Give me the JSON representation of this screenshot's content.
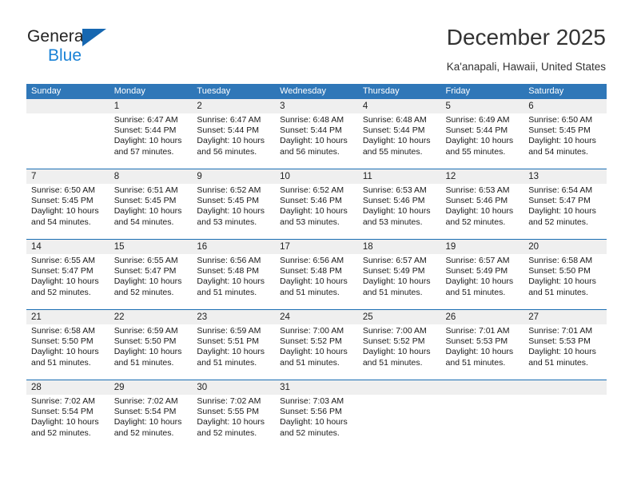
{
  "brand": {
    "name_part1": "General",
    "name_part2": "Blue",
    "accent_color": "#1a82d6",
    "triangle_color": "#1667b1"
  },
  "header": {
    "title": "December 2025",
    "location": "Ka'anapali, Hawaii, United States",
    "header_bg": "#2f77b8",
    "row_separator_color": "#1a6eb4",
    "daynum_bg": "#efefef"
  },
  "weekday_headers": [
    "Sunday",
    "Monday",
    "Tuesday",
    "Wednesday",
    "Thursday",
    "Friday",
    "Saturday"
  ],
  "weeks": [
    {
      "days": [
        {
          "num": "",
          "sunrise": "",
          "sunset": "",
          "daylight_1": "",
          "daylight_2": ""
        },
        {
          "num": "1",
          "sunrise": "Sunrise: 6:47 AM",
          "sunset": "Sunset: 5:44 PM",
          "daylight_1": "Daylight: 10 hours",
          "daylight_2": "and 57 minutes."
        },
        {
          "num": "2",
          "sunrise": "Sunrise: 6:47 AM",
          "sunset": "Sunset: 5:44 PM",
          "daylight_1": "Daylight: 10 hours",
          "daylight_2": "and 56 minutes."
        },
        {
          "num": "3",
          "sunrise": "Sunrise: 6:48 AM",
          "sunset": "Sunset: 5:44 PM",
          "daylight_1": "Daylight: 10 hours",
          "daylight_2": "and 56 minutes."
        },
        {
          "num": "4",
          "sunrise": "Sunrise: 6:48 AM",
          "sunset": "Sunset: 5:44 PM",
          "daylight_1": "Daylight: 10 hours",
          "daylight_2": "and 55 minutes."
        },
        {
          "num": "5",
          "sunrise": "Sunrise: 6:49 AM",
          "sunset": "Sunset: 5:44 PM",
          "daylight_1": "Daylight: 10 hours",
          "daylight_2": "and 55 minutes."
        },
        {
          "num": "6",
          "sunrise": "Sunrise: 6:50 AM",
          "sunset": "Sunset: 5:45 PM",
          "daylight_1": "Daylight: 10 hours",
          "daylight_2": "and 54 minutes."
        }
      ]
    },
    {
      "days": [
        {
          "num": "7",
          "sunrise": "Sunrise: 6:50 AM",
          "sunset": "Sunset: 5:45 PM",
          "daylight_1": "Daylight: 10 hours",
          "daylight_2": "and 54 minutes."
        },
        {
          "num": "8",
          "sunrise": "Sunrise: 6:51 AM",
          "sunset": "Sunset: 5:45 PM",
          "daylight_1": "Daylight: 10 hours",
          "daylight_2": "and 54 minutes."
        },
        {
          "num": "9",
          "sunrise": "Sunrise: 6:52 AM",
          "sunset": "Sunset: 5:45 PM",
          "daylight_1": "Daylight: 10 hours",
          "daylight_2": "and 53 minutes."
        },
        {
          "num": "10",
          "sunrise": "Sunrise: 6:52 AM",
          "sunset": "Sunset: 5:46 PM",
          "daylight_1": "Daylight: 10 hours",
          "daylight_2": "and 53 minutes."
        },
        {
          "num": "11",
          "sunrise": "Sunrise: 6:53 AM",
          "sunset": "Sunset: 5:46 PM",
          "daylight_1": "Daylight: 10 hours",
          "daylight_2": "and 53 minutes."
        },
        {
          "num": "12",
          "sunrise": "Sunrise: 6:53 AM",
          "sunset": "Sunset: 5:46 PM",
          "daylight_1": "Daylight: 10 hours",
          "daylight_2": "and 52 minutes."
        },
        {
          "num": "13",
          "sunrise": "Sunrise: 6:54 AM",
          "sunset": "Sunset: 5:47 PM",
          "daylight_1": "Daylight: 10 hours",
          "daylight_2": "and 52 minutes."
        }
      ]
    },
    {
      "days": [
        {
          "num": "14",
          "sunrise": "Sunrise: 6:55 AM",
          "sunset": "Sunset: 5:47 PM",
          "daylight_1": "Daylight: 10 hours",
          "daylight_2": "and 52 minutes."
        },
        {
          "num": "15",
          "sunrise": "Sunrise: 6:55 AM",
          "sunset": "Sunset: 5:47 PM",
          "daylight_1": "Daylight: 10 hours",
          "daylight_2": "and 52 minutes."
        },
        {
          "num": "16",
          "sunrise": "Sunrise: 6:56 AM",
          "sunset": "Sunset: 5:48 PM",
          "daylight_1": "Daylight: 10 hours",
          "daylight_2": "and 51 minutes."
        },
        {
          "num": "17",
          "sunrise": "Sunrise: 6:56 AM",
          "sunset": "Sunset: 5:48 PM",
          "daylight_1": "Daylight: 10 hours",
          "daylight_2": "and 51 minutes."
        },
        {
          "num": "18",
          "sunrise": "Sunrise: 6:57 AM",
          "sunset": "Sunset: 5:49 PM",
          "daylight_1": "Daylight: 10 hours",
          "daylight_2": "and 51 minutes."
        },
        {
          "num": "19",
          "sunrise": "Sunrise: 6:57 AM",
          "sunset": "Sunset: 5:49 PM",
          "daylight_1": "Daylight: 10 hours",
          "daylight_2": "and 51 minutes."
        },
        {
          "num": "20",
          "sunrise": "Sunrise: 6:58 AM",
          "sunset": "Sunset: 5:50 PM",
          "daylight_1": "Daylight: 10 hours",
          "daylight_2": "and 51 minutes."
        }
      ]
    },
    {
      "days": [
        {
          "num": "21",
          "sunrise": "Sunrise: 6:58 AM",
          "sunset": "Sunset: 5:50 PM",
          "daylight_1": "Daylight: 10 hours",
          "daylight_2": "and 51 minutes."
        },
        {
          "num": "22",
          "sunrise": "Sunrise: 6:59 AM",
          "sunset": "Sunset: 5:50 PM",
          "daylight_1": "Daylight: 10 hours",
          "daylight_2": "and 51 minutes."
        },
        {
          "num": "23",
          "sunrise": "Sunrise: 6:59 AM",
          "sunset": "Sunset: 5:51 PM",
          "daylight_1": "Daylight: 10 hours",
          "daylight_2": "and 51 minutes."
        },
        {
          "num": "24",
          "sunrise": "Sunrise: 7:00 AM",
          "sunset": "Sunset: 5:52 PM",
          "daylight_1": "Daylight: 10 hours",
          "daylight_2": "and 51 minutes."
        },
        {
          "num": "25",
          "sunrise": "Sunrise: 7:00 AM",
          "sunset": "Sunset: 5:52 PM",
          "daylight_1": "Daylight: 10 hours",
          "daylight_2": "and 51 minutes."
        },
        {
          "num": "26",
          "sunrise": "Sunrise: 7:01 AM",
          "sunset": "Sunset: 5:53 PM",
          "daylight_1": "Daylight: 10 hours",
          "daylight_2": "and 51 minutes."
        },
        {
          "num": "27",
          "sunrise": "Sunrise: 7:01 AM",
          "sunset": "Sunset: 5:53 PM",
          "daylight_1": "Daylight: 10 hours",
          "daylight_2": "and 51 minutes."
        }
      ]
    },
    {
      "days": [
        {
          "num": "28",
          "sunrise": "Sunrise: 7:02 AM",
          "sunset": "Sunset: 5:54 PM",
          "daylight_1": "Daylight: 10 hours",
          "daylight_2": "and 52 minutes."
        },
        {
          "num": "29",
          "sunrise": "Sunrise: 7:02 AM",
          "sunset": "Sunset: 5:54 PM",
          "daylight_1": "Daylight: 10 hours",
          "daylight_2": "and 52 minutes."
        },
        {
          "num": "30",
          "sunrise": "Sunrise: 7:02 AM",
          "sunset": "Sunset: 5:55 PM",
          "daylight_1": "Daylight: 10 hours",
          "daylight_2": "and 52 minutes."
        },
        {
          "num": "31",
          "sunrise": "Sunrise: 7:03 AM",
          "sunset": "Sunset: 5:56 PM",
          "daylight_1": "Daylight: 10 hours",
          "daylight_2": "and 52 minutes."
        },
        {
          "num": "",
          "sunrise": "",
          "sunset": "",
          "daylight_1": "",
          "daylight_2": ""
        },
        {
          "num": "",
          "sunrise": "",
          "sunset": "",
          "daylight_1": "",
          "daylight_2": ""
        },
        {
          "num": "",
          "sunrise": "",
          "sunset": "",
          "daylight_1": "",
          "daylight_2": ""
        }
      ]
    }
  ]
}
